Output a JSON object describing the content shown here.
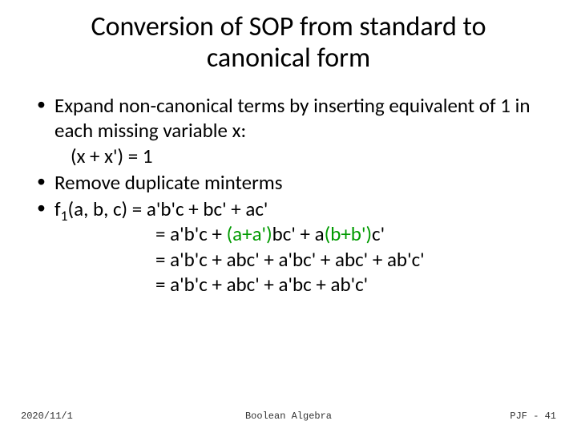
{
  "title": "Conversion of SOP from standard to canonical form",
  "bullets": {
    "b1_a": "Expand non-canonical terms by inserting equivalent of 1 in each missing variable x:",
    "b1_b": "(x + x') = 1",
    "b2": "Remove duplicate minterms",
    "b3_lead": "f",
    "b3_sub": "1",
    "b3_head": "(a, b, c) = a'b'c + bc' + ac'",
    "b3_l2a": "= a'b'c + ",
    "b3_l2_ins1": "(a+a')",
    "b3_l2b": "bc' + a",
    "b3_l2_ins2": "(b+b')",
    "b3_l2c": "c'",
    "b3_l3": "= a'b'c + abc' + a'bc' + abc' + ab'c'",
    "b3_l4": "= a'b'c + abc' + a'bc + ab'c'"
  },
  "footer": {
    "date": "2020/11/1",
    "center": "Boolean Algebra",
    "right": "PJF - 41"
  }
}
